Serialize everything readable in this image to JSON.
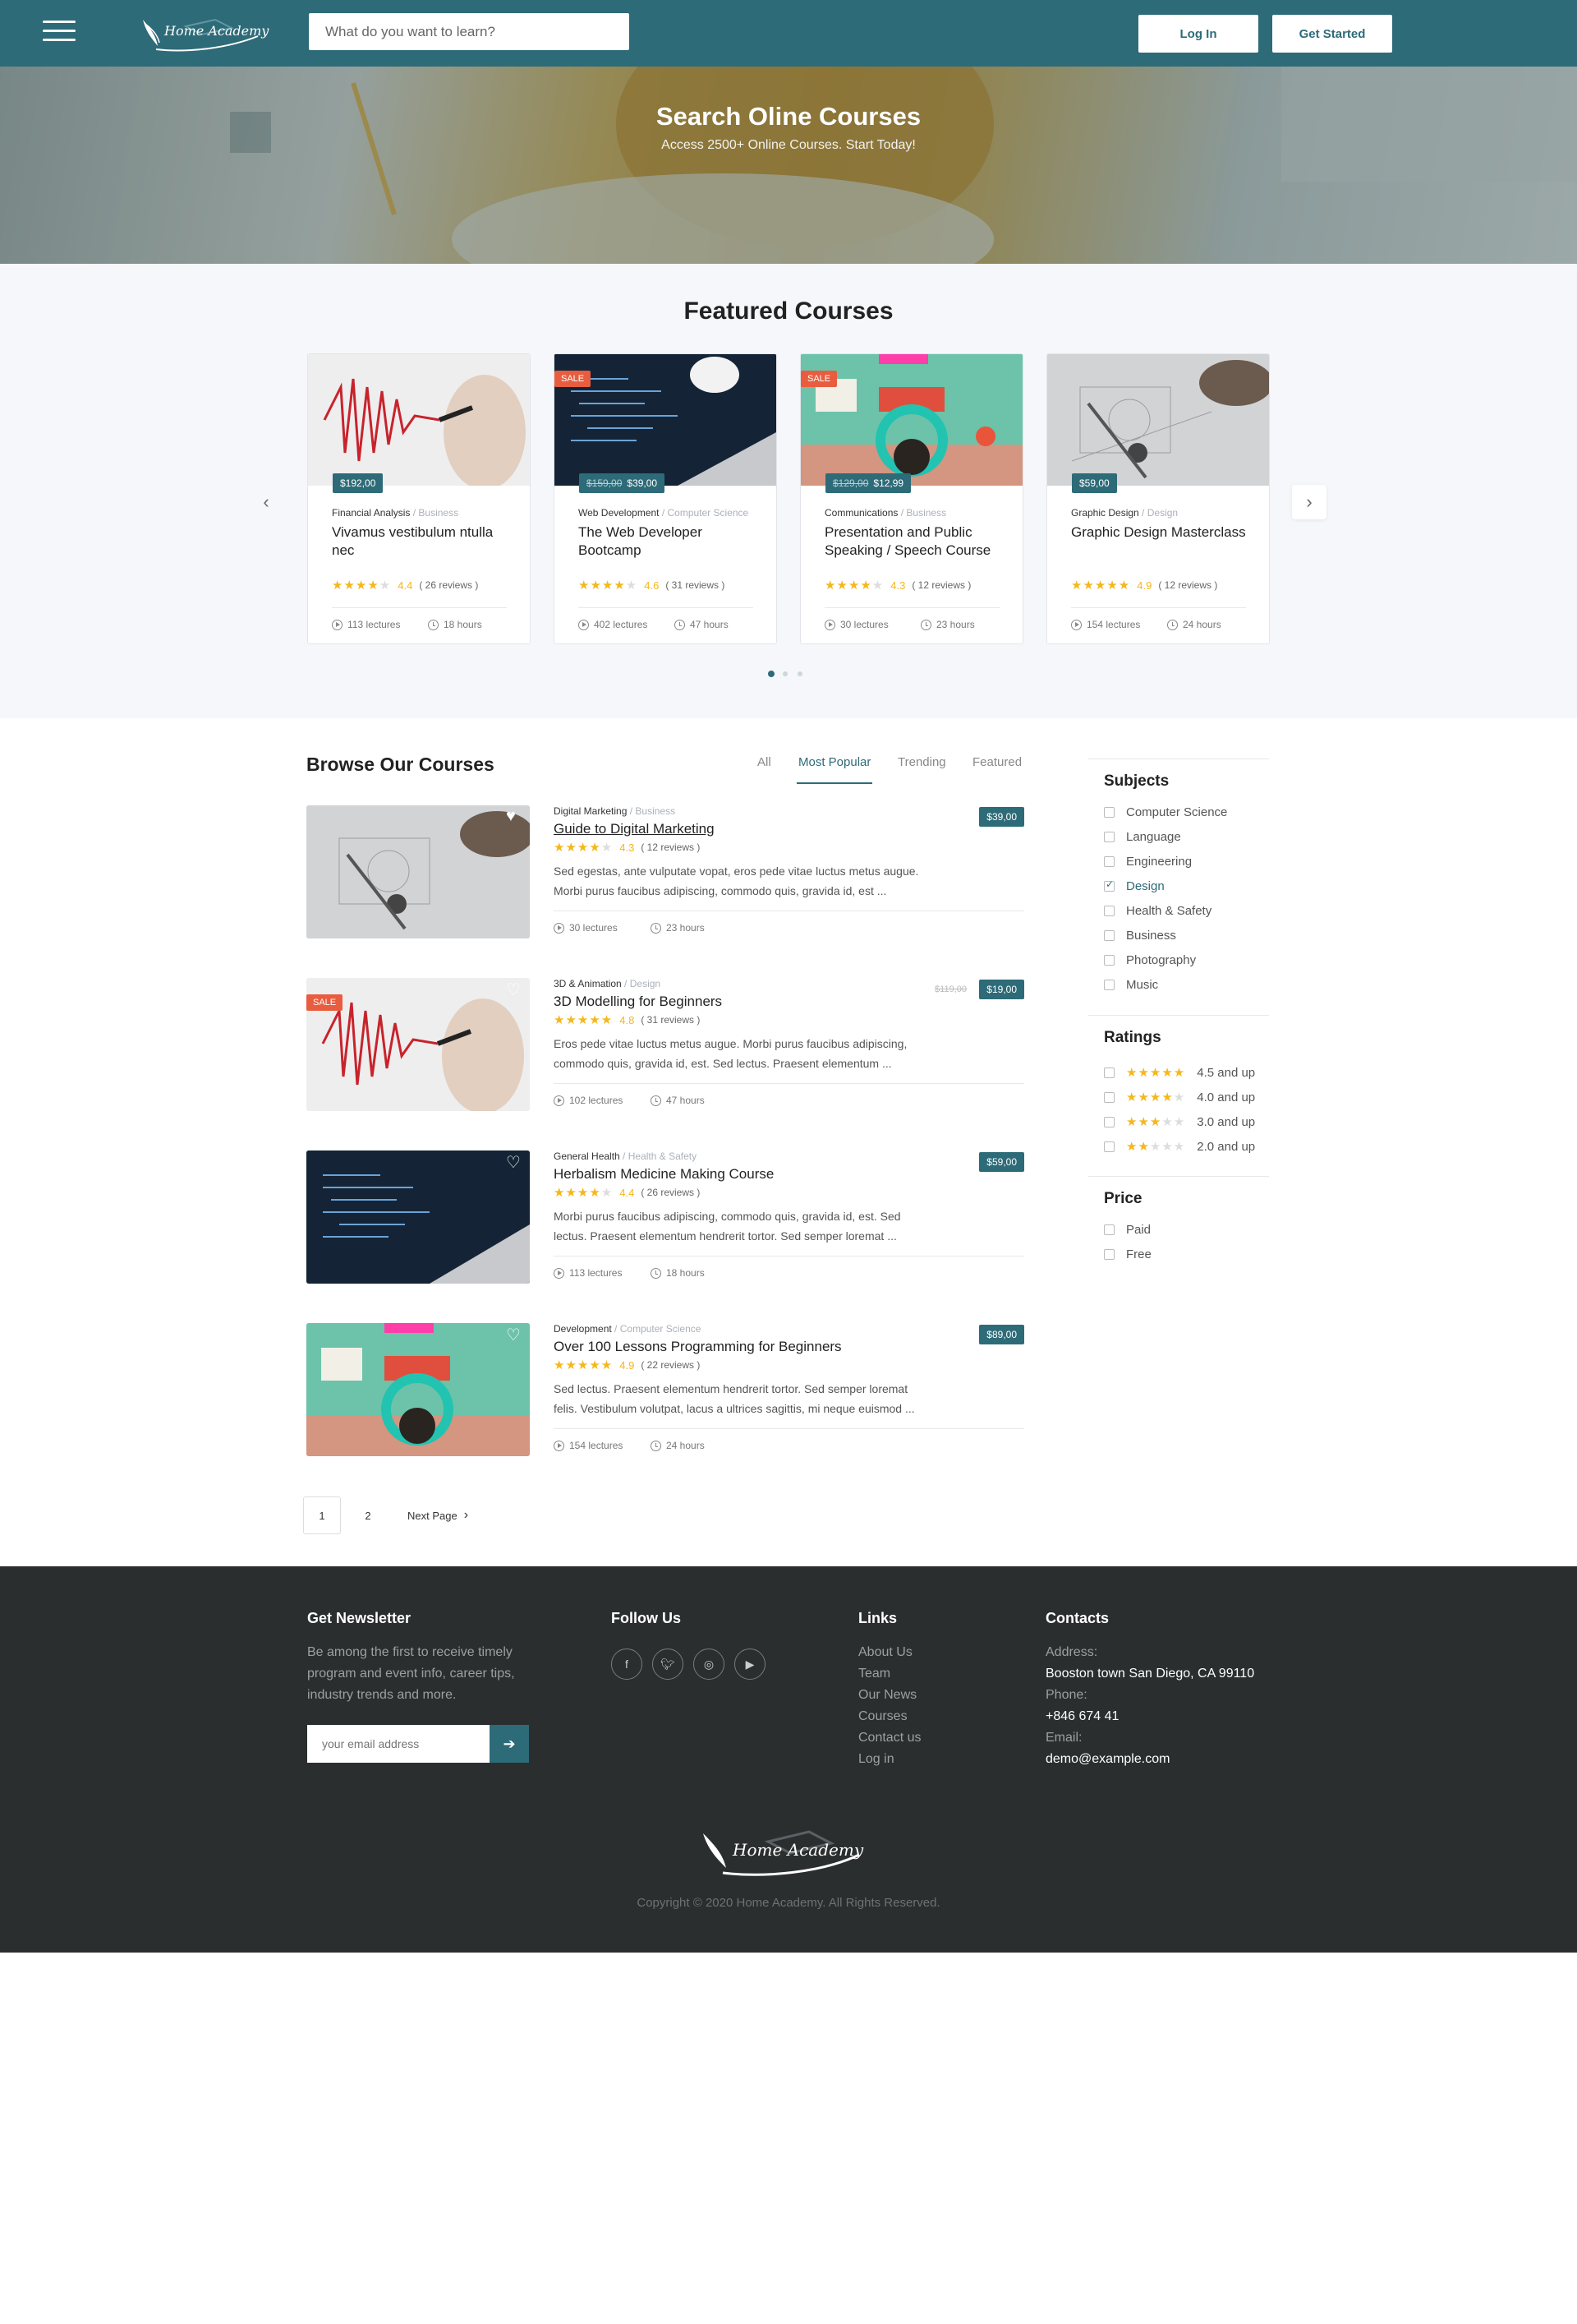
{
  "header": {
    "logo_text": "Home Academy",
    "search_placeholder": "What do you want to learn?",
    "login_label": "Log In",
    "get_started_label": "Get Started"
  },
  "hero": {
    "title": "Search Oline Courses",
    "subtitle": "Access 2500+ Online Courses. Start Today!"
  },
  "featured": {
    "title": "Featured Courses",
    "courses": [
      {
        "price": "$192,00",
        "old_price": "",
        "sale": false,
        "category": "Financial Analysis",
        "subcategory": "Business",
        "title": "Vivamus vestibulum ntulla nec",
        "rating": 4.4,
        "rating_text": "4.4",
        "reviews": "( 26 reviews )",
        "lectures": "113 lectures",
        "hours": "18 hours"
      },
      {
        "price": "$39,00",
        "old_price": "$159,00",
        "sale": true,
        "sale_label": "SALE",
        "category": "Web Development",
        "subcategory": "Computer Science",
        "title": "The Web Developer Bootcamp",
        "rating": 4.6,
        "rating_text": "4.6",
        "reviews": "( 31 reviews )",
        "lectures": "402 lectures",
        "hours": "47 hours"
      },
      {
        "price": "$12,99",
        "old_price": "$129,00",
        "sale": true,
        "sale_label": "SALE",
        "category": "Communications",
        "subcategory": "Business",
        "title": "Presentation and Public Speaking / Speech Course",
        "rating": 4.3,
        "rating_text": "4.3",
        "reviews": "( 12 reviews )",
        "lectures": "30 lectures",
        "hours": "23 hours"
      },
      {
        "price": "$59,00",
        "old_price": "",
        "sale": false,
        "category": "Graphic Design",
        "subcategory": "Design",
        "title": "Graphic Design Masterclass",
        "rating": 4.9,
        "rating_text": "4.9",
        "reviews": "( 12 reviews )",
        "lectures": "154 lectures",
        "hours": "24 hours"
      }
    ]
  },
  "browse": {
    "title": "Browse Our Courses",
    "tabs": [
      "All",
      "Most Popular",
      "Trending",
      "Featured"
    ],
    "active_tab": "Most Popular",
    "items": [
      {
        "category": "Digital Marketing",
        "subcategory": "Business",
        "title": "Guide to Digital Marketing",
        "rating": 4.3,
        "rating_text": "4.3",
        "reviews": "( 12 reviews )",
        "desc1": "Sed egestas, ante vulputate vopat, eros pede vitae luctus metus augue.",
        "desc2": "Morbi purus faucibus adipiscing, commodo quis, gravida id, est ...",
        "price": "$39,00",
        "old_price": "",
        "sale": false,
        "lectures": "30 lectures",
        "hours": "23 hours"
      },
      {
        "category": "3D & Animation",
        "subcategory": "Design",
        "title": "3D Modelling for Beginners",
        "rating": 4.8,
        "rating_text": "4.8",
        "reviews": "( 31 reviews )",
        "desc1": "Eros pede vitae luctus metus augue. Morbi purus faucibus adipiscing,",
        "desc2": "commodo quis, gravida id, est. Sed lectus. Praesent elementum ...",
        "price": "$19,00",
        "old_price": "$119,00",
        "sale": true,
        "sale_label": "SALE",
        "lectures": "102 lectures",
        "hours": "47 hours"
      },
      {
        "category": "General Health",
        "subcategory": "Health & Safety",
        "title": "Herbalism Medicine Making Course",
        "rating": 4.4,
        "rating_text": "4.4",
        "reviews": "( 26 reviews )",
        "desc1": "Morbi purus faucibus adipiscing, commodo quis, gravida id, est. Sed",
        "desc2": "lectus. Praesent elementum hendrerit tortor. Sed semper loremat ...",
        "price": "$59,00",
        "old_price": "",
        "sale": false,
        "lectures": "113 lectures",
        "hours": "18 hours"
      },
      {
        "category": "Development",
        "subcategory": "Computer Science",
        "title": "Over 100 Lessons Programming for Beginners",
        "rating": 4.9,
        "rating_text": "4.9",
        "reviews": "( 22 reviews )",
        "desc1": "Sed lectus. Praesent elementum hendrerit tortor. Sed semper loremat",
        "desc2": "felis. Vestibulum volutpat, lacus a ultrices sagittis, mi neque euismod ...",
        "price": "$89,00",
        "old_price": "",
        "sale": false,
        "lectures": "154 lectures",
        "hours": "24 hours"
      }
    ],
    "pagination": {
      "page1": "1",
      "page2": "2",
      "next": "Next Page"
    }
  },
  "sidebar": {
    "subjects_title": "Subjects",
    "subjects": [
      "Computer Science",
      "Language",
      "Engineering",
      "Design",
      "Health & Safety",
      "Business",
      "Photography",
      "Music"
    ],
    "checked_subject": "Design",
    "ratings_title": "Ratings",
    "ratings": [
      {
        "label": "4.5 and up",
        "stars": 4.5
      },
      {
        "label": "4.0 and up",
        "stars": 4
      },
      {
        "label": "3.0 and up",
        "stars": 3
      },
      {
        "label": "2.0 and up",
        "stars": 2
      }
    ],
    "price_title": "Price",
    "prices": [
      "Paid",
      "Free"
    ]
  },
  "footer": {
    "newsletter_title": "Get Newsletter",
    "newsletter_text": [
      "Be among the first to receive timely",
      "program and event info, career tips,",
      "industry trends and more."
    ],
    "email_placeholder": "your email address",
    "follow_title": "Follow Us",
    "social_icons": [
      "facebook-icon",
      "twitter-icon",
      "instagram-icon",
      "youtube-icon"
    ],
    "links_title": "Links",
    "links": [
      "About Us",
      "Team",
      "Our News",
      "Courses",
      "Contact us",
      "Log in"
    ],
    "contacts_title": "Contacts",
    "address_label": "Address:",
    "address": "Booston town San Diego, CA 99110",
    "phone_label": "Phone:",
    "phone": "+846 674 41",
    "email_label": "Email:",
    "email": "demo@example.com",
    "logo_text": "Home Academy",
    "copyright": "Copyright © 2020 Home Academy. All Rights Reserved."
  },
  "colors": {
    "brand": "#2e6b78",
    "sale": "#e85d3f",
    "star": "#f5b71a",
    "footer_bg": "#2b2e2f"
  }
}
